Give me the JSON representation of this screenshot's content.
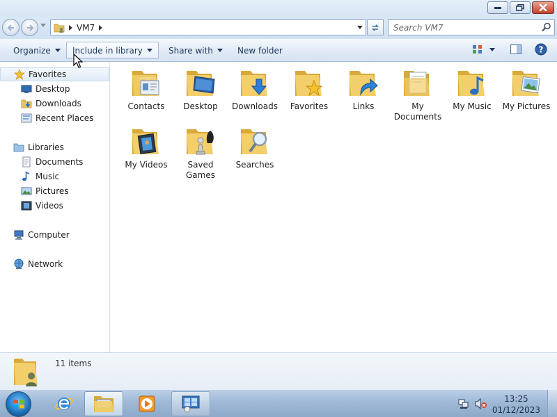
{
  "window": {
    "address": {
      "crumbs": [
        "VM7"
      ],
      "search_placeholder": "Search VM7"
    },
    "commands": {
      "organize": "Organize",
      "include_in_library": "Include in library",
      "share_with": "Share with",
      "new_folder": "New folder"
    },
    "nav": {
      "favorites": "Favorites",
      "desktop": "Desktop",
      "downloads": "Downloads",
      "recent_places": "Recent Places",
      "libraries": "Libraries",
      "documents": "Documents",
      "music": "Music",
      "pictures": "Pictures",
      "videos": "Videos",
      "computer": "Computer",
      "network": "Network"
    },
    "items": [
      {
        "label": "Contacts",
        "icon": "contacts-folder-icon"
      },
      {
        "label": "Desktop",
        "icon": "desktop-folder-icon"
      },
      {
        "label": "Downloads",
        "icon": "downloads-folder-icon"
      },
      {
        "label": "Favorites",
        "icon": "favorites-folder-icon"
      },
      {
        "label": "Links",
        "icon": "links-folder-icon"
      },
      {
        "label": "My Documents",
        "icon": "documents-folder-icon"
      },
      {
        "label": "My Music",
        "icon": "music-folder-icon"
      },
      {
        "label": "My Pictures",
        "icon": "pictures-folder-icon"
      },
      {
        "label": "My Videos",
        "icon": "videos-folder-icon"
      },
      {
        "label": "Saved Games",
        "icon": "saved-games-folder-icon"
      },
      {
        "label": "Searches",
        "icon": "searches-folder-icon"
      }
    ],
    "details": {
      "count": "11 items"
    }
  },
  "taskbar": {
    "time": "13:25",
    "date": "01/12/2023"
  },
  "colors": {
    "folder": "#f2cf6a",
    "folder_dark": "#d9a93a",
    "accent": "#1e395b"
  }
}
